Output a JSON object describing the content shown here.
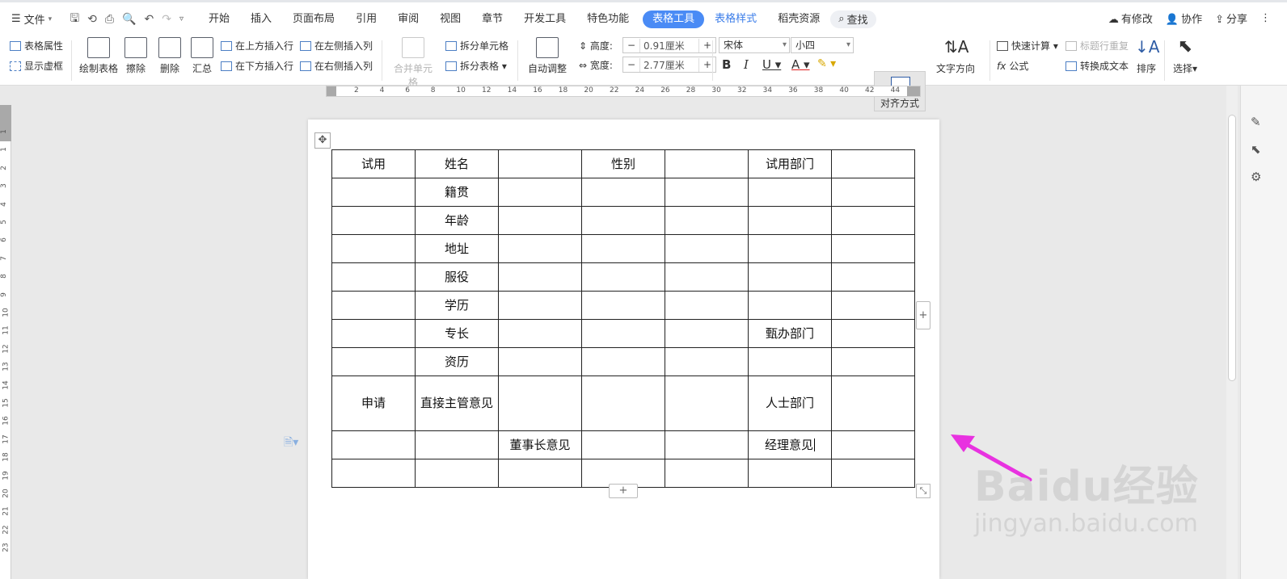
{
  "menubar": {
    "file_label": "文件",
    "tabs": [
      "开始",
      "插入",
      "页面布局",
      "引用",
      "审阅",
      "视图",
      "章节",
      "开发工具",
      "特色功能"
    ],
    "active_tab": "表格工具",
    "style_tab": "表格样式",
    "resource_tab": "稻壳资源",
    "search_label": "查找",
    "modify_label": "有修改",
    "collab_label": "协作",
    "share_label": "分享"
  },
  "ribbon": {
    "table_props": "表格属性",
    "show_gridlines": "显示虚框",
    "draw_table": "绘制表格",
    "erase": "擦除",
    "delete": "删除",
    "summary": "汇总",
    "insert_above": "在上方插入行",
    "insert_below": "在下方插入行",
    "insert_left": "在左侧插入列",
    "insert_right": "在右侧插入列",
    "merge_cells": "合并单元格",
    "split_cells": "拆分单元格",
    "split_table": "拆分表格",
    "auto_fit": "自动调整",
    "height_label": "高度:",
    "height_value": "0.91厘米",
    "width_label": "宽度:",
    "width_value": "2.77厘米",
    "font_name": "宋体",
    "font_size": "小四",
    "align": "对齐方式",
    "text_direction": "文字方向",
    "quick_calc": "快速计算",
    "title_repeat": "标题行重复",
    "formula": "公式",
    "to_text": "转换成文本",
    "sort": "排序",
    "select": "选择"
  },
  "ruler": {
    "h_ticks": [
      "2",
      "4",
      "6",
      "8",
      "10",
      "12",
      "14",
      "16",
      "18",
      "20",
      "22",
      "24",
      "26",
      "28",
      "30",
      "32",
      "34",
      "36",
      "38",
      "40",
      "42",
      "44"
    ],
    "v_ticks": [
      "1",
      "1",
      "2",
      "3",
      "4",
      "5",
      "6",
      "7",
      "8",
      "9",
      "10",
      "11",
      "12",
      "13",
      "14",
      "15",
      "16",
      "17",
      "18",
      "19",
      "20",
      "21",
      "22",
      "23"
    ]
  },
  "table": {
    "rows": [
      [
        "试用",
        "姓名",
        "",
        "性别",
        "",
        "试用部门",
        ""
      ],
      [
        "",
        "籍贯",
        "",
        "",
        "",
        "",
        ""
      ],
      [
        "",
        "年龄",
        "",
        "",
        "",
        "",
        ""
      ],
      [
        "",
        "地址",
        "",
        "",
        "",
        "",
        ""
      ],
      [
        "",
        "服役",
        "",
        "",
        "",
        "",
        ""
      ],
      [
        "",
        "学历",
        "",
        "",
        "",
        "",
        ""
      ],
      [
        "",
        "专长",
        "",
        "",
        "",
        "甄办部门",
        ""
      ],
      [
        "",
        "资历",
        "",
        "",
        "",
        "",
        ""
      ],
      [
        "申请",
        "直接主管意见",
        "",
        "",
        "",
        "人士部门",
        ""
      ],
      [
        "",
        "",
        "董事长意见",
        "",
        "",
        "经理意见",
        ""
      ],
      [
        "",
        "",
        "",
        "",
        "",
        "",
        ""
      ]
    ]
  },
  "watermark": {
    "brand": "Baidu经验",
    "url": "jingyan.baidu.com"
  },
  "colors": {
    "accent": "#4a8bf5",
    "arrow": "#e832e0"
  }
}
